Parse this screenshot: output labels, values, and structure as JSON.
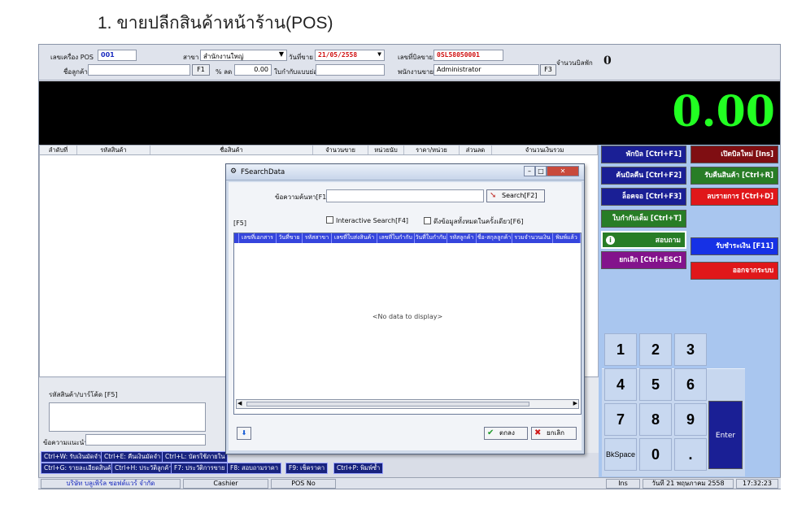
{
  "heading": "1.  ขายปลีกสินค้าหน้าร้าน(POS)",
  "header": {
    "pos_label": "เลขเครื่อง POS",
    "pos_value": "001",
    "branch_label": "สาขา",
    "branch_value": "สำนักงานใหญ่",
    "date_label": "วันที่ขาย",
    "date_value": "21/05/2558",
    "doc_label": "เลขที่บิลขาย",
    "doc_value": "0SL58050001",
    "bill_count_label": "จำนวนบิลพัก",
    "bill_count_value": "0",
    "customer_label": "ชื่อลูกค้า",
    "f1": "F1",
    "discount_label": "% ลด",
    "discount_value": "0.00",
    "point_label": "ใบกำกับแบบย่อ",
    "cashier_label": "พนักงานขาย",
    "cashier_value": "Administrator",
    "f3": "F3"
  },
  "total": "0.00",
  "grid_columns": [
    "ลำดับที่",
    "รหัสสินค้า",
    "ชื่อสินค้า",
    "จำนวนขาย",
    "หน่วยนับ",
    "ราคา/หน่วย",
    "ส่วนลด",
    "จำนวนเงินรวม"
  ],
  "barcode": {
    "label": "รหัสสินค้า/บาร์โค้ด [F5]",
    "note_label": "ข้อความแนะนำ"
  },
  "shortcuts_row1": [
    "Ctrl+W: รับเงินมัดจำ",
    "Ctrl+E: คืนเงินมัดจำ",
    "Ctrl+L: บัตรใช้ภายใน"
  ],
  "shortcuts_row2": [
    "Ctrl+G: รายละเอียดสินค้า",
    "Ctrl+H: ประวัติลูกค้า",
    "F7: ประวัติการขาย",
    "F8: สอบถามราคา",
    "F9: เช็คราคา",
    "Ctrl+P: พิมพ์ซ้ำ"
  ],
  "right_buttons": {
    "hold": "พักบิล [Ctrl+F1]",
    "new_bill": "เปิดบิลใหม่ [Ins]",
    "find_return": "ค้นบิลคืน [Ctrl+F2]",
    "receive_return": "รับคืนสินค้า [Ctrl+R]",
    "lock": "ล็อคจอ [Ctrl+F3]",
    "delete_item": "ลบรายการ [Ctrl+D]",
    "full_invoice": "ใบกำกับเต็ม [Ctrl+T]",
    "inquiry": "สอบถาม",
    "pay": "รับชำระเงิน [F11]",
    "cancel": "ยกเลิก [Ctrl+ESC]",
    "exit": "ออกจากระบบ"
  },
  "keypad": {
    "k1": "1",
    "k2": "2",
    "k3": "3",
    "k4": "4",
    "k5": "5",
    "k6": "6",
    "k7": "7",
    "k8": "8",
    "k9": "9",
    "bksp": "BkSpace",
    "k0": "0",
    "dot": ".",
    "enter": "Enter"
  },
  "status": {
    "company": "บริษัท บลูเพิร์ล ซอฟต์แวร์ จำกัด",
    "cashier": "Cashier",
    "pos": "POS No",
    "ins": "Ins",
    "date": "วันที่ 21 พฤษภาคม 2558",
    "time": "17:32:23"
  },
  "dialog": {
    "title": "FSearchData",
    "search_label": "ข้อความค้นหา[F1]",
    "search_value": "",
    "search_button": "Search[F2]",
    "f5": "[F5]",
    "interactive": "Interactive Search[F4]",
    "show_all": "ดึงข้อมูลทั้งหมดในครั้งเดียว[F6]",
    "columns": [
      "เลขที่เอกสาร",
      "วันที่ขาย",
      "รหัสสาขา",
      "เลขที่ใบส่งสินค้า",
      "เลขที่ใบกำกับ",
      "วันที่ใบกำกับ",
      "รหัสลูกค้า",
      "ชื่อ-สกุลลูกค้า",
      "รวมจำนวนเงิน",
      "พิมพ์แล้ว"
    ],
    "empty": "<No data to display>",
    "ok": "ตกลง",
    "cancel": "ยกเลิก"
  }
}
